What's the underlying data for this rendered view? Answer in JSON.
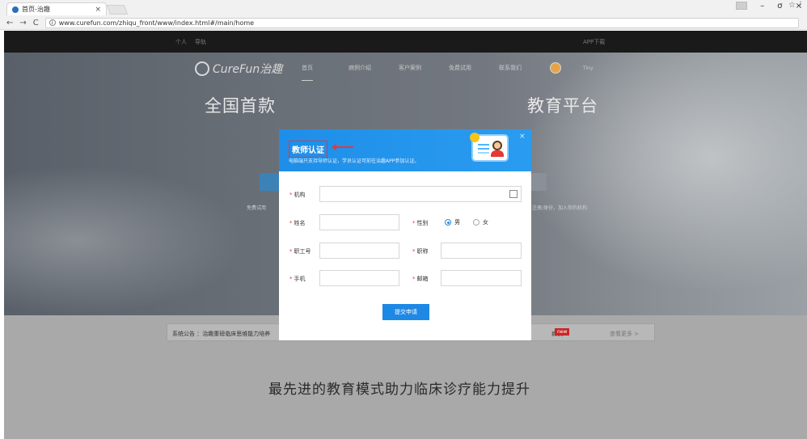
{
  "browser": {
    "tab_title": "首页-治趣",
    "url": "www.curefun.com/zhiqu_front/www/index.html#/main/home",
    "close_icon": "close-icon",
    "nav": {
      "back": "←",
      "forward": "→",
      "reload": "C",
      "info": "i"
    },
    "window": {
      "minimize": "–",
      "maximize": "σ",
      "close": "×"
    },
    "star": "☆",
    "menu": "⋮"
  },
  "site": {
    "topbar": {
      "left_items": [
        "个人",
        "导轨"
      ],
      "right_item": "APP下载"
    },
    "logo_text": "CureFun治趣",
    "menu": [
      "首页",
      "病例介绍",
      "客户案例",
      "免费试用",
      "联系我们"
    ],
    "user_name": "Tiny",
    "hero_title_left": "全国首款",
    "hero_title_right": "教育平台",
    "hero_sub_left": "免费试用",
    "hero_sub_right": "注册/身份，加入你的机构",
    "notice": {
      "left": "系统公告 ：治趣重磅临床思维能力培养",
      "num": "病例 7",
      "new_badge": "new",
      "more": "查看更多 >"
    },
    "slogan": "最先进的教育模式助力临床诊疗能力提升"
  },
  "modal": {
    "title": "教师认证",
    "subtitle": "电脑端只支持导师认证，学员认证可前往治趣APP参加认证。",
    "close_label": "×",
    "fields": {
      "institution": {
        "label": "机构"
      },
      "name": {
        "label": "姓名"
      },
      "gender": {
        "label": "性别",
        "options": [
          "男",
          "女"
        ],
        "selected": "男"
      },
      "employee_id": {
        "label": "职工号"
      },
      "title": {
        "label": "职称"
      },
      "phone": {
        "label": "手机"
      },
      "email": {
        "label": "邮箱"
      }
    },
    "required_mark": "*",
    "scan_icon": "scan-icon",
    "submit_label": "提交申请"
  },
  "colors": {
    "accent": "#1e88e5",
    "header_bg": "#1a1a1a",
    "highlight": "#e53935"
  }
}
